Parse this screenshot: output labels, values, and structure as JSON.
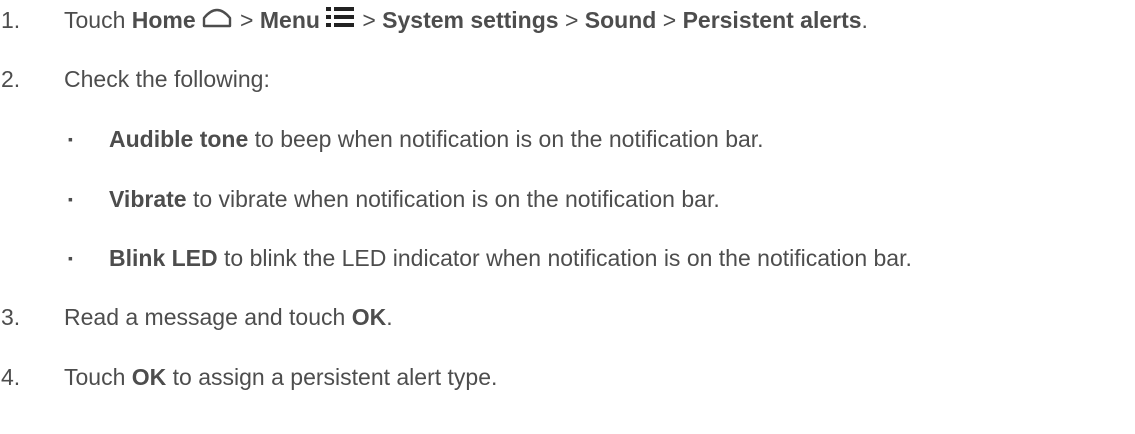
{
  "steps": [
    {
      "number": "1.",
      "parts": {
        "t0": "Touch ",
        "home": "Home",
        "sep1": " > ",
        "menu": "Menu",
        "sep2": " > ",
        "system_settings": "System settings",
        "sep3": " > ",
        "sound": "Sound",
        "sep4": " > ",
        "persistent_alerts": "Persistent alerts",
        "end": "."
      },
      "icons": [
        "home-icon",
        "menu-icon"
      ]
    },
    {
      "number": "2.",
      "text": "Check the following:",
      "sub_items": [
        {
          "bullet": "▪",
          "bold": "Audible tone",
          "rest": " to beep when notification is on the notification bar."
        },
        {
          "bullet": "▪",
          "bold": "Vibrate",
          "rest": " to vibrate when notification is on the notification bar."
        },
        {
          "bullet": "▪",
          "bold": "Blink LED",
          "rest": " to blink the LED indicator when notification is on the notification bar."
        }
      ]
    },
    {
      "number": "3.",
      "parts": {
        "t0": "Read a message and touch ",
        "bold": "OK",
        "end": "."
      }
    },
    {
      "number": "4.",
      "parts": {
        "t0": "Touch ",
        "bold": "OK",
        "end": " to assign a persistent alert type."
      }
    }
  ],
  "colors": {
    "text": "#4d4d4d",
    "background": "#ffffff"
  }
}
